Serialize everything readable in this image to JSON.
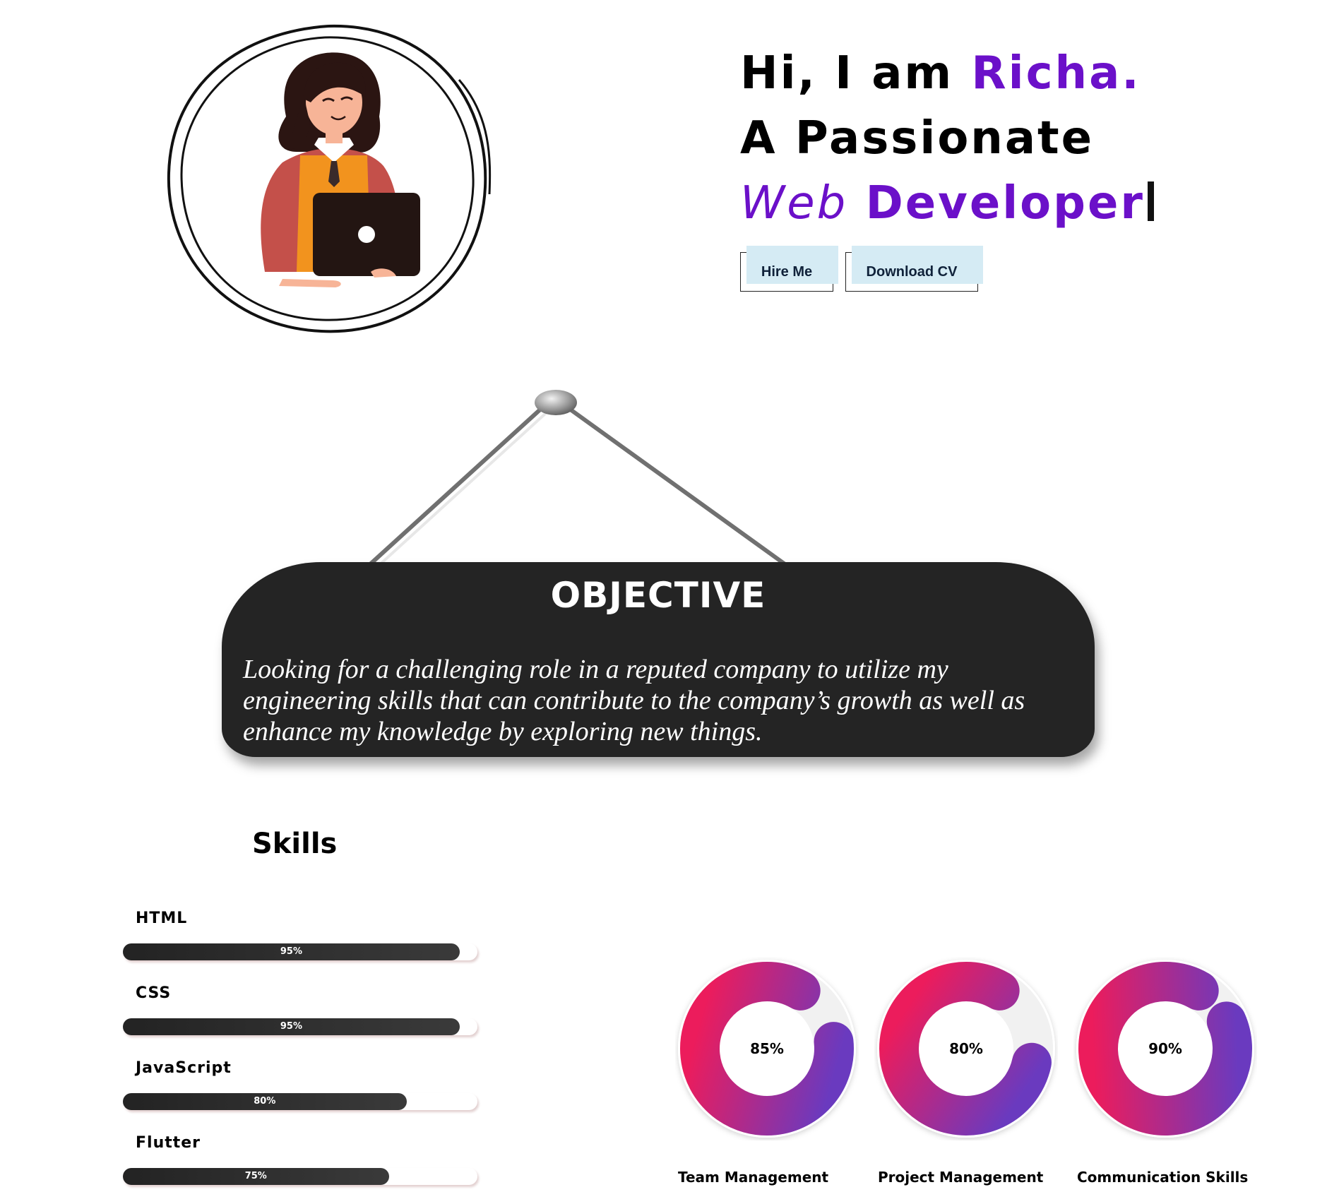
{
  "hero": {
    "line1_prefix": "Hi, I am ",
    "line1_name": "Richa.",
    "line2": "A Passionate",
    "line3_word1": "Web",
    "line3_word2": "Developer",
    "hire_label": "Hire Me",
    "cv_label": "Download CV"
  },
  "objective": {
    "title": "OBJECTIVE",
    "text": "Looking for a challenging role in a reputed company to utilize my engineering skills that can contribute to the company’s growth as well as enhance my knowledge by exploring new things."
  },
  "skills": {
    "title": "Skills",
    "items": [
      {
        "name": "HTML",
        "percent_label": "95%",
        "value": 95
      },
      {
        "name": "CSS",
        "percent_label": "95%",
        "value": 95
      },
      {
        "name": "JavaScript",
        "percent_label": "80%",
        "value": 80
      },
      {
        "name": "Flutter",
        "percent_label": "75%",
        "value": 75
      }
    ]
  },
  "soft_skills": [
    {
      "name": "Team Management",
      "percent_label": "85%",
      "value": 85
    },
    {
      "name": "Project Management",
      "percent_label": "80%",
      "value": 80
    },
    {
      "name": "Communication Skills",
      "percent_label": "90%",
      "value": 90
    }
  ],
  "colors": {
    "accent_purple": "#6b10c9",
    "ring_start": "#ec1c5c",
    "ring_end": "#6a3abf",
    "sign_bg": "#242424",
    "button_highlight": "#d5ebf4"
  }
}
